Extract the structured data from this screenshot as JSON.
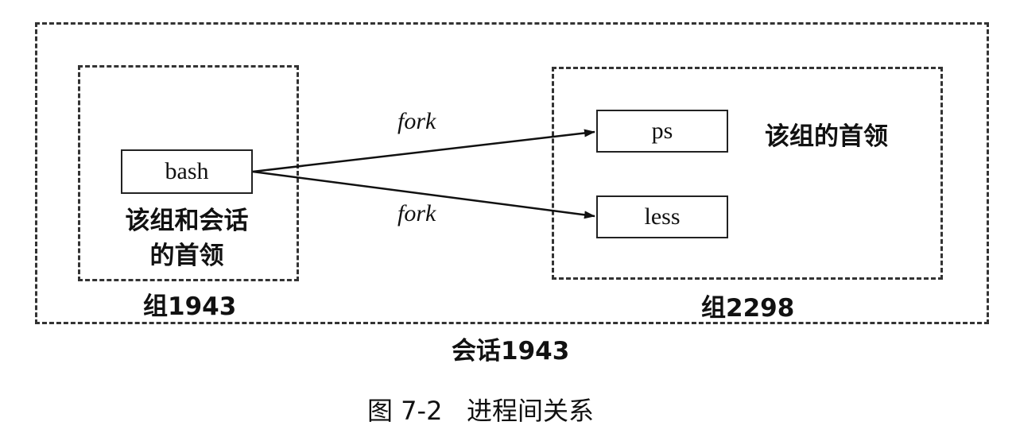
{
  "session": {
    "label": "会话1943"
  },
  "group_left": {
    "label": "组1943",
    "process": "bash",
    "role_line1": "该组和会话",
    "role_line2": "的首领"
  },
  "group_right": {
    "label": "组2298",
    "process_top": "ps",
    "process_bottom": "less",
    "role": "该组的首领"
  },
  "edges": {
    "top": "fork",
    "bottom": "fork"
  },
  "figure": {
    "caption": "图 7-2   进程间关系"
  }
}
